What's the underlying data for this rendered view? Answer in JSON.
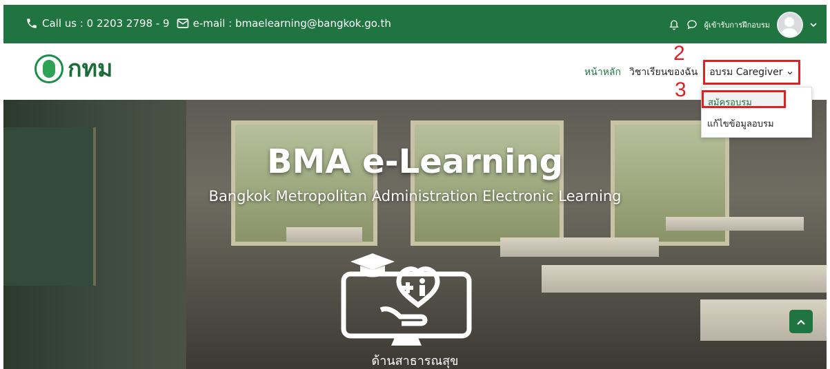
{
  "topbar": {
    "contact_text": "Call us : 0 2203 2798 - 9",
    "email_text": "e-mail : bmaelearning@bangkok.go.th",
    "user_role": "ผู้เข้ารับการฝึกอบรม"
  },
  "brand": {
    "logo_text": "กทม"
  },
  "nav": {
    "home": "หน้าหลัก",
    "my_courses": "วิชาเรียนของฉัน",
    "caregiver": "อบรม Caregiver",
    "caregiver_menu": [
      {
        "label": "สมัครอบรม"
      },
      {
        "label": "แก้ไขข้อมูลอบรม"
      }
    ]
  },
  "annotations": {
    "step2": "2",
    "step3": "3"
  },
  "hero": {
    "title": "BMA e-Learning",
    "subtitle": "Bangkok Metropolitan Administration Electronic Learning",
    "category_caption": "ด้านสาธารณสุข"
  },
  "colors": {
    "brand_green": "#1f7440",
    "annotation_red": "#e02020"
  }
}
